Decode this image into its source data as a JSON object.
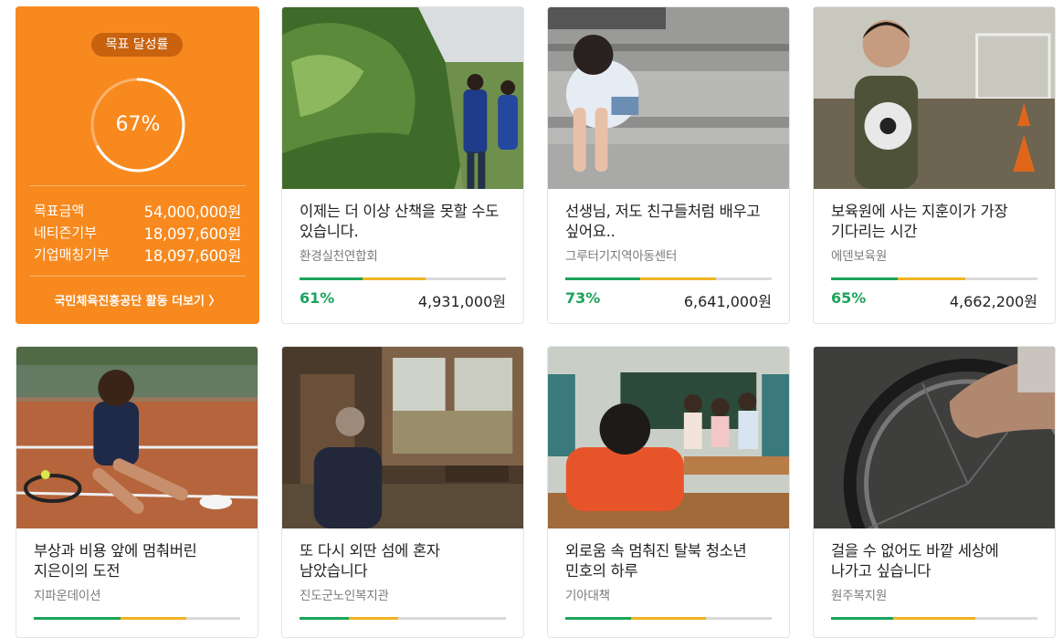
{
  "goal_panel": {
    "badge": "목표 달성률",
    "percent_text": "67%",
    "percent_value": 0.67,
    "rows": [
      {
        "label": "목표금액",
        "value": "54,000,000원"
      },
      {
        "label": "네티즌기부",
        "value": "18,097,600원"
      },
      {
        "label": "기업매칭기부",
        "value": "18,097,600원"
      }
    ],
    "more_link": "국민체육진흥공단 활동 더보기 〉"
  },
  "cards": [
    {
      "title": "이제는 더 이상 산책을 못할 수도 있습니다.",
      "org": "환경실천연합회",
      "percent": "61%",
      "amount": "4,931,000원",
      "progress": 0.61,
      "image": "volunteers-in-green-field"
    },
    {
      "title": "선생님, 저도 친구들처럼 배우고 싶어요..",
      "org": "그루터기지역아동센터",
      "percent": "73%",
      "amount": "6,641,000원",
      "progress": 0.73,
      "image": "girl-sitting-on-stairs"
    },
    {
      "title": "보육원에 사는 지훈이가 가장 기다리는 시간",
      "org": "에덴보육원",
      "percent": "65%",
      "amount": "4,662,200원",
      "progress": 0.65,
      "image": "boy-holding-soccer-ball"
    },
    {
      "title": "부상과 비용 앞에 멈춰버린 지은이의 도전",
      "org": "지파운데이션",
      "image": "tennis-player-on-court"
    },
    {
      "title": "또 다시 외딴 섬에 혼자 남았습니다",
      "org": "진도군노인복지관",
      "image": "elderly-man-by-window"
    },
    {
      "title": "외로움 속 멈춰진 탈북 청소년 민호의 하루",
      "org": "기아대책",
      "image": "student-head-down-in-classroom"
    },
    {
      "title": "걸을 수 없어도 바깥 세상에 나가고 싶습니다",
      "org": "원주복지원",
      "image": "hand-on-wheelchair"
    }
  ],
  "colors": {
    "orange": "#f7891e",
    "green": "#1aa35a",
    "yellow": "#f0b323",
    "track": "#dadada"
  }
}
